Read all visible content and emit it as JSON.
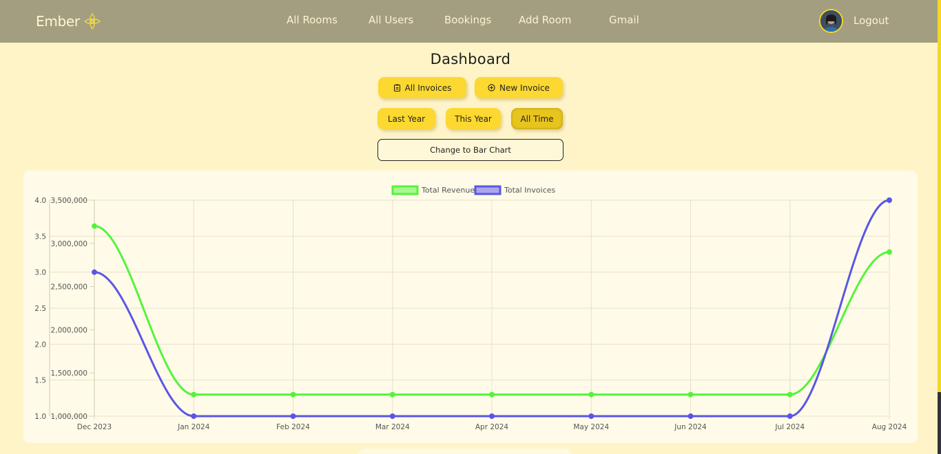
{
  "nav": {
    "brand": "Ember",
    "links": [
      "All Rooms",
      "All Users",
      "Bookings",
      "Add Room",
      "Gmail"
    ],
    "logout": "Logout"
  },
  "page": {
    "title": "Dashboard"
  },
  "actions": {
    "all_invoices": "All Invoices",
    "new_invoice": "New Invoice"
  },
  "filters": {
    "last_year": "Last Year",
    "this_year": "This Year",
    "all_time": "All Time",
    "selected": "All Time"
  },
  "toggle_chart": "Change to Bar Chart",
  "colors": {
    "revenue": "#55f33b",
    "invoices": "#5a55e6",
    "accent": "#fcd830",
    "navbar": "#a39e80"
  },
  "chart_data": {
    "type": "line",
    "x": [
      "Dec 2023",
      "Jan 2024",
      "Feb 2024",
      "Mar 2024",
      "Apr 2024",
      "May 2024",
      "Jun 2024",
      "Jul 2024",
      "Aug 2024"
    ],
    "series": [
      {
        "name": "Total Revenue",
        "axis": "right",
        "values": [
          3200000,
          1250000,
          1250000,
          1250000,
          1250000,
          1250000,
          1250000,
          1250000,
          2900000
        ]
      },
      {
        "name": "Total Invoices",
        "axis": "left",
        "values": [
          3,
          1,
          1,
          1,
          1,
          1,
          1,
          1,
          4
        ]
      }
    ],
    "y_left": {
      "ticks": [
        "1.0",
        "1.5",
        "2.0",
        "2.5",
        "3.0",
        "3.5",
        "4.0"
      ],
      "range": [
        1,
        4
      ]
    },
    "y_right": {
      "ticks": [
        "1,000,000",
        "1,500,000",
        "2,000,000",
        "2,500,000",
        "3,000,000",
        "3,500,000"
      ],
      "range": [
        1000000,
        3500000
      ]
    },
    "grid": true,
    "legend": "top-center"
  }
}
